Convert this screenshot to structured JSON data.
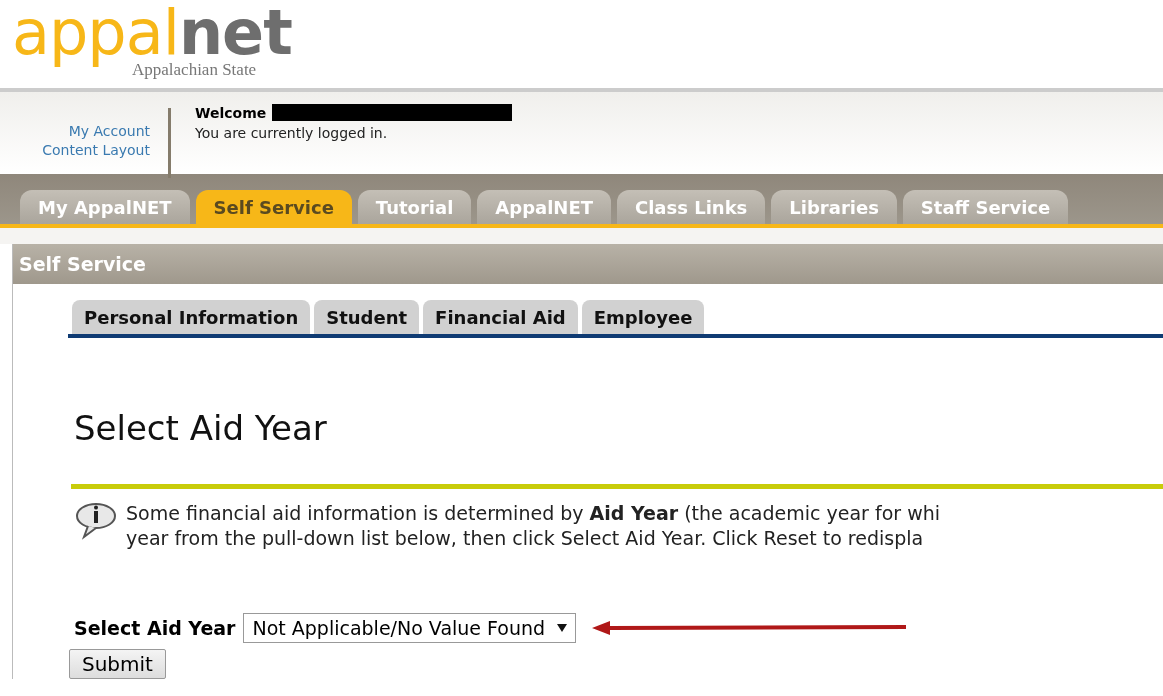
{
  "logo": {
    "brand_primary": "appal",
    "brand_secondary": "net",
    "tagline": "Appalachian State"
  },
  "account_links": [
    "My Account",
    "Content Layout"
  ],
  "welcome": {
    "label": "Welcome",
    "status": "You are currently logged in."
  },
  "main_tabs": [
    {
      "label": "My AppalNET",
      "selected": false
    },
    {
      "label": "Self Service",
      "selected": true
    },
    {
      "label": "Tutorial",
      "selected": false
    },
    {
      "label": "AppalNET",
      "selected": false
    },
    {
      "label": "Class Links",
      "selected": false
    },
    {
      "label": "Libraries",
      "selected": false
    },
    {
      "label": "Staff Service",
      "selected": false
    }
  ],
  "panel_title": "Self Service",
  "sub_tabs": [
    "Personal Information",
    "Student",
    "Financial Aid",
    "Employee"
  ],
  "page_title": "Select Aid Year",
  "info_lines": [
    "Some financial aid information is determined by **Aid Year** (the academic year for whi",
    "year from the pull-down list below, then click Select Aid Year. Click Reset to redispla"
  ],
  "aid_year_field": {
    "label": "Select Aid Year",
    "value": "Not Applicable/No Value Found"
  },
  "submit_button": "Submit"
}
